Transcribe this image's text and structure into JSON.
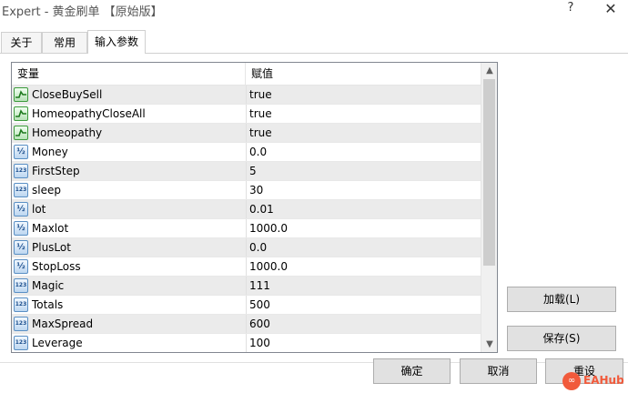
{
  "window": {
    "title": "Expert - 黄金刷单 【原始版】",
    "help_label": "?",
    "close_label": "✕"
  },
  "tabs": [
    {
      "label": "关于",
      "active": false
    },
    {
      "label": "常用",
      "active": false
    },
    {
      "label": "输入参数",
      "active": true
    }
  ],
  "grid": {
    "headers": {
      "variable": "变量",
      "value": "赋值"
    },
    "rows": [
      {
        "name": "CloseBuySell",
        "value": "true",
        "type": "bool",
        "icon": "bool-param-icon"
      },
      {
        "name": "HomeopathyCloseAll",
        "value": "true",
        "type": "bool",
        "icon": "bool-param-icon"
      },
      {
        "name": "Homeopathy",
        "value": "true",
        "type": "bool",
        "icon": "bool-param-icon"
      },
      {
        "name": "Money",
        "value": "0.0",
        "type": "double",
        "icon": "double-param-icon"
      },
      {
        "name": "FirstStep",
        "value": "5",
        "type": "int",
        "icon": "int-param-icon"
      },
      {
        "name": "sleep",
        "value": "30",
        "type": "int",
        "icon": "int-param-icon"
      },
      {
        "name": "lot",
        "value": "0.01",
        "type": "double",
        "icon": "double-param-icon"
      },
      {
        "name": "Maxlot",
        "value": "1000.0",
        "type": "double",
        "icon": "double-param-icon"
      },
      {
        "name": "PlusLot",
        "value": "0.0",
        "type": "double",
        "icon": "double-param-icon"
      },
      {
        "name": "StopLoss",
        "value": "1000.0",
        "type": "double",
        "icon": "double-param-icon"
      },
      {
        "name": "Magic",
        "value": "111",
        "type": "int",
        "icon": "int-param-icon"
      },
      {
        "name": "Totals",
        "value": "500",
        "type": "int",
        "icon": "int-param-icon"
      },
      {
        "name": "MaxSpread",
        "value": "600",
        "type": "int",
        "icon": "int-param-icon"
      },
      {
        "name": "Leverage",
        "value": "100",
        "type": "int",
        "icon": "int-param-icon"
      }
    ],
    "icon_glyphs": {
      "double": "½",
      "int": "123"
    }
  },
  "buttons": {
    "load": "加载(L)",
    "save": "保存(S)",
    "ok": "确定",
    "cancel": "取消",
    "reset": "重设"
  },
  "scrollbar": {
    "up": "▲",
    "down": "▼"
  },
  "watermark": {
    "text": "EAHub"
  }
}
